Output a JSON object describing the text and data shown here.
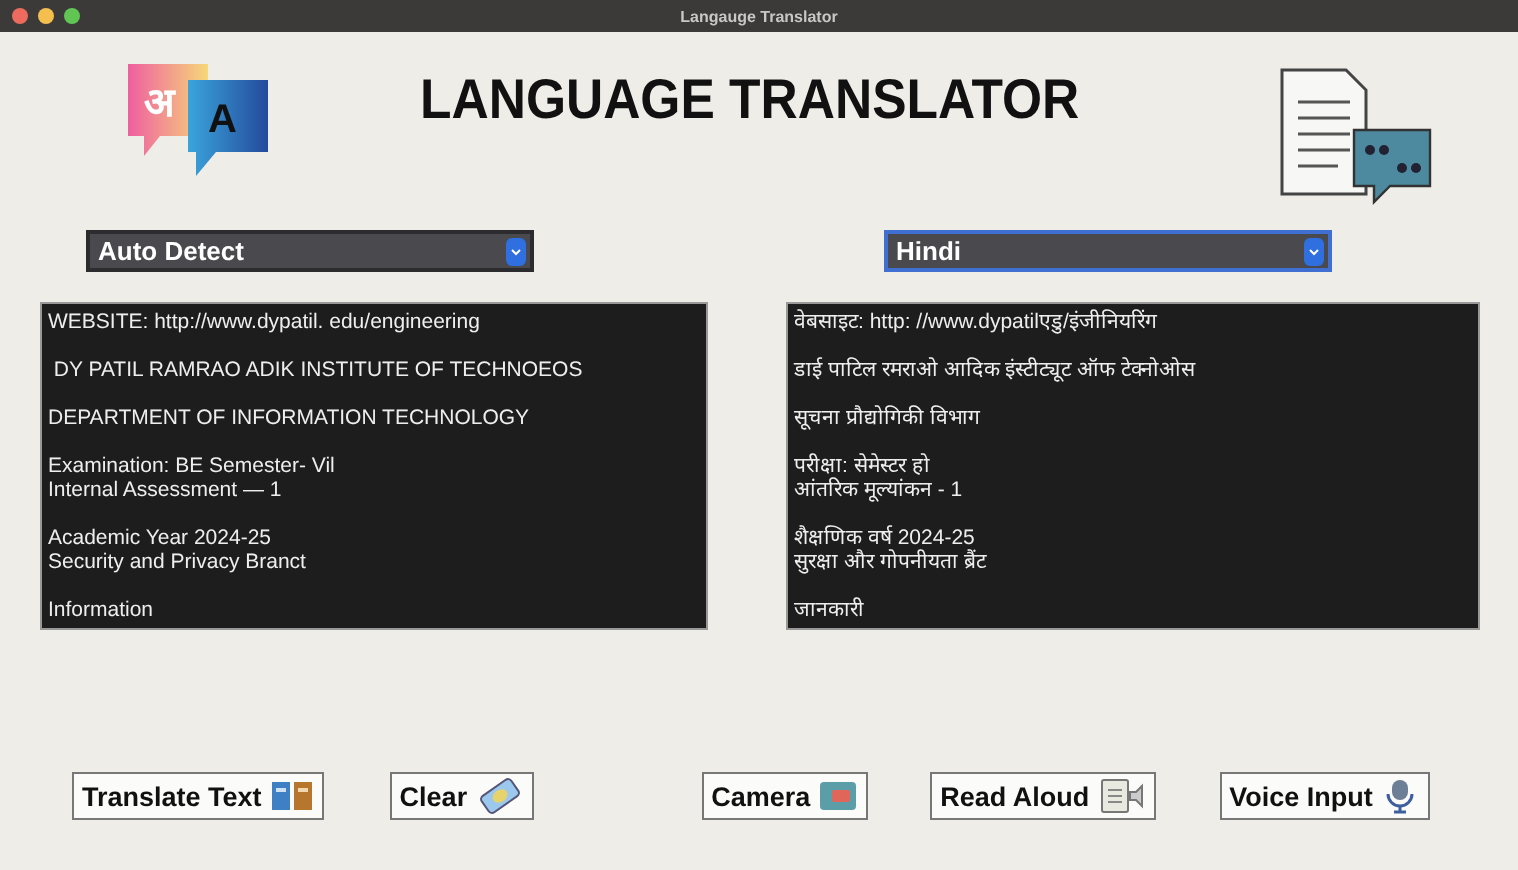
{
  "window": {
    "title": "Langauge Translator"
  },
  "logo": {
    "letters": [
      "अ",
      "A"
    ]
  },
  "heading": "LANGUAGE TRANSLATOR",
  "source_language": {
    "value": "Auto Detect",
    "focused": false
  },
  "target_language": {
    "value": "Hindi",
    "focused": true
  },
  "source_text": [
    [
      "WEBSITE: http://www.dypatil. edu/engineering"
    ],
    [
      " DY PATIL RAMRAO ADIK INSTITUTE OF TECHNOEOS"
    ],
    [
      "DEPARTMENT OF INFORMATION TECHNOLOGY"
    ],
    [
      "Examination: BE Semester- Vil",
      "Internal Assessment — 1"
    ],
    [
      "Academic Year 2024-25",
      "Security and Privacy Branct"
    ],
    [
      "Information"
    ]
  ],
  "translated_text": [
    [
      "वेबसाइट: http: //www.dypatilएडु/इंजीनियरिंग"
    ],
    [
      "डाई पाटिल रमराओ आदिक इंस्टीट्यूट ऑफ टेक्नोओस"
    ],
    [
      "सूचना प्रौद्योगिकी विभाग"
    ],
    [
      "परीक्षा: सेमेस्टर हो",
      "आंतरिक मूल्यांकन - 1"
    ],
    [
      "शैक्षणिक वर्ष 2024-25",
      "सुरक्षा और गोपनीयता ब्रैंट"
    ],
    [
      "जानकारी"
    ]
  ],
  "buttons": [
    {
      "label": "Translate Text",
      "kind": "translate"
    },
    {
      "label": "Clear",
      "kind": "clear"
    },
    {
      "label": "Camera",
      "kind": "camera"
    },
    {
      "label": "Read Aloud",
      "kind": "read"
    },
    {
      "label": "Voice Input",
      "kind": "voice"
    }
  ]
}
